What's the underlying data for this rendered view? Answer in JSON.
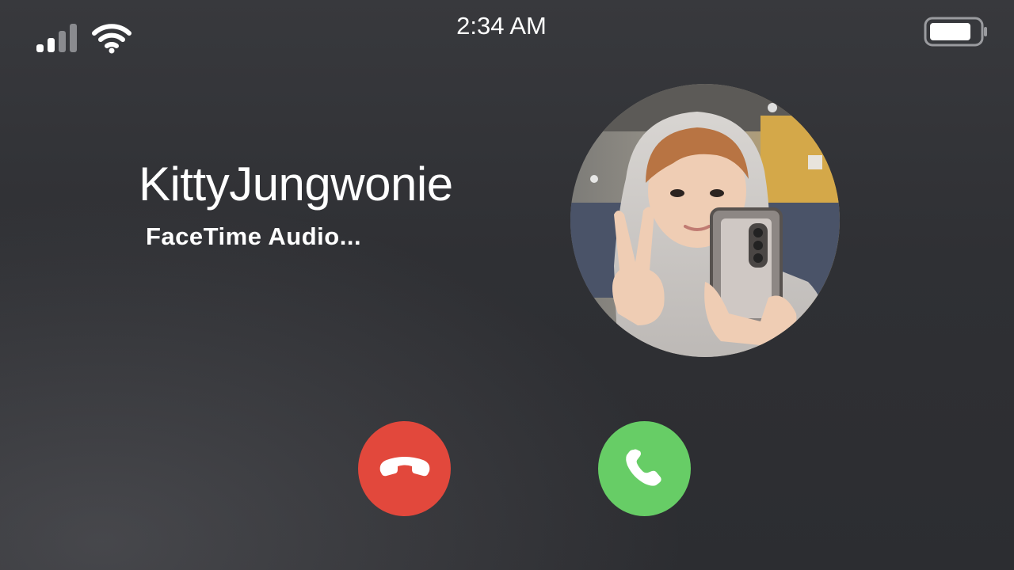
{
  "status_bar": {
    "time": "2:34 AM",
    "icons": [
      "cellular-signal-icon",
      "wifi-icon",
      "battery-icon"
    ],
    "signal_bars_active": 2,
    "signal_bars_total": 4,
    "battery_level": 0.85
  },
  "call": {
    "caller_name": "KittyJungwonie",
    "status": "FaceTime Audio...",
    "avatar_icon": "contact-photo"
  },
  "actions": {
    "decline": {
      "icon": "phone-hangup-icon",
      "color": "#e2483c"
    },
    "accept": {
      "icon": "phone-icon",
      "color": "#67cd66"
    }
  },
  "colors": {
    "background": "#2f3034",
    "text": "#ffffff"
  }
}
